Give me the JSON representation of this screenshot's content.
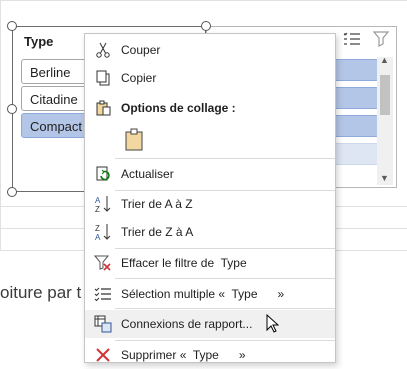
{
  "sheet": {
    "bottom_text": "oiture par t"
  },
  "slicer": {
    "title": "Type",
    "items": [
      "Berline",
      "Citadine",
      "Compact"
    ],
    "selected_index": 2
  },
  "menu": {
    "items": [
      {
        "label": "Couper",
        "icon": "scissors-icon"
      },
      {
        "label": "Copier",
        "icon": "copy-icon"
      },
      {
        "label": "Options de collage :",
        "icon": "paste-icon"
      },
      {
        "label": "Actualiser",
        "icon": "refresh-icon"
      },
      {
        "label": "Trier de A à Z",
        "icon": "sort-az-icon"
      },
      {
        "label": "Trier de Z à A",
        "icon": "sort-za-icon"
      },
      {
        "label": "Effacer le filtre de  Type",
        "icon": "clear-filter-icon"
      },
      {
        "label": "Sélection multiple «  Type      »",
        "icon": "multiselect-icon"
      },
      {
        "label": "Connexions de rapport...",
        "icon": "report-connections-icon"
      },
      {
        "label": "Supprimer «  Type      »",
        "icon": "delete-icon"
      }
    ],
    "hovered_index": 8
  },
  "colors": {
    "selected_item": "#b4c6e7",
    "accent_red": "#d13438",
    "accent_blue": "#2b579a"
  }
}
